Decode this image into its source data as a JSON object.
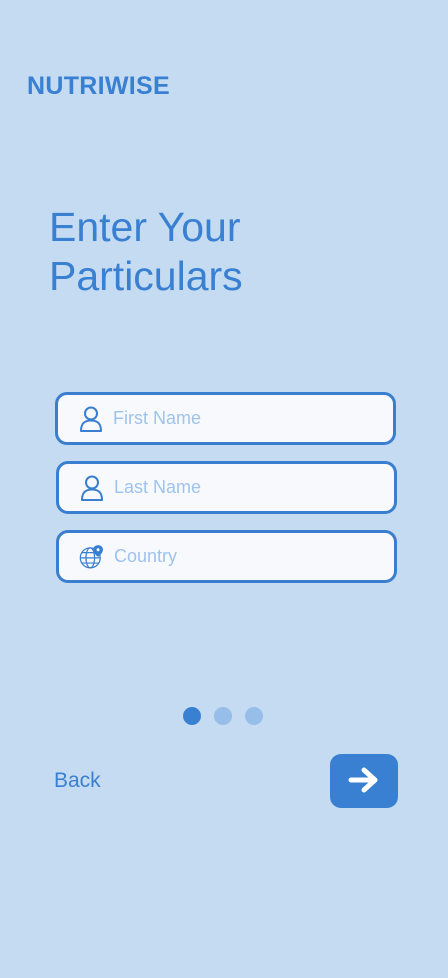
{
  "app": {
    "brand": "NUTRIWISE"
  },
  "heading": {
    "line1": "Enter Your",
    "line2": "Particulars"
  },
  "form": {
    "first_name": {
      "placeholder": "First Name",
      "value": ""
    },
    "last_name": {
      "placeholder": "Last Name",
      "value": ""
    },
    "country": {
      "placeholder": "Country",
      "value": ""
    }
  },
  "pager": {
    "total": 3,
    "current": 1
  },
  "nav": {
    "back_label": "Back",
    "next_icon": "arrow-right-icon"
  },
  "colors": {
    "accent": "#3a80d2",
    "background": "#c4dbf1",
    "placeholder": "#9fc3ec"
  }
}
